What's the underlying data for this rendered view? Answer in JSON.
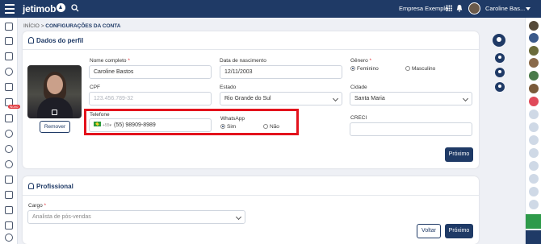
{
  "topbar": {
    "logo": "jetimob",
    "company": "Empresa Exemplo",
    "user": "Caroline Bas..."
  },
  "breadcrumb": {
    "home": "INÍCIO",
    "separator": ">",
    "current": "CONFIGURAÇÕES DA CONTA"
  },
  "profile": {
    "title": "Dados do perfil",
    "remove_button": "Remover",
    "full_name": {
      "label": "Nome completo",
      "required": "*",
      "value": "Caroline Bastos"
    },
    "birth_date": {
      "label": "Data de nascimento",
      "value": "12/11/2003"
    },
    "gender": {
      "label": "Gênero",
      "required": "*",
      "options": [
        "Feminino",
        "Masculino"
      ],
      "selected": "Feminino"
    },
    "cpf": {
      "label": "CPF",
      "placeholder": "123.456.789-32"
    },
    "state": {
      "label": "Estado",
      "value": "Rio Grande do Sul"
    },
    "city": {
      "label": "Cidade",
      "value": "Santa Maria"
    },
    "phone": {
      "label": "Telefone",
      "country_code": "+55",
      "value": "(55) 98909-8989"
    },
    "whatsapp": {
      "label": "WhatsApp",
      "options": [
        "Sim",
        "Não"
      ],
      "selected": "Sim"
    },
    "creci": {
      "label": "CRECI",
      "value": ""
    },
    "next_button": "Próximo"
  },
  "professional": {
    "title": "Profissional",
    "role": {
      "label": "Cargo",
      "required": "*",
      "value": "Analista de pós-vendas"
    },
    "back_button": "Voltar",
    "next_button": "Próximo"
  },
  "colors": {
    "navy": "#1f3a66",
    "highlight_red": "#e3121c",
    "required_red": "#e0353b"
  },
  "sidebar_icons": [
    "grid-icon",
    "home-icon",
    "building-icon",
    "key-icon",
    "tool-icon",
    "network-icon",
    "document-icon",
    "people-icon",
    "target-icon",
    "check-icon",
    "megaphone-icon",
    "book-icon",
    "money-icon",
    "file-icon",
    "info-icon"
  ],
  "sidebar_badge": "Novo"
}
